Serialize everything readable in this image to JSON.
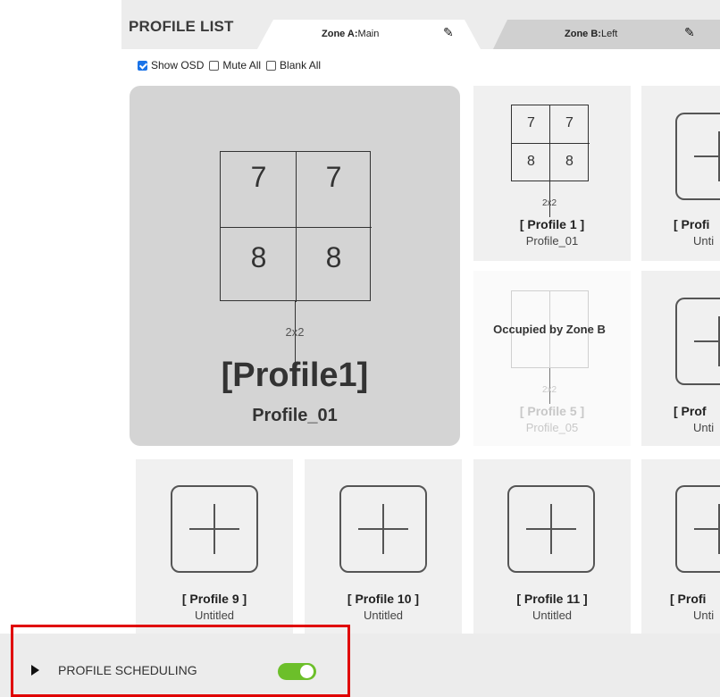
{
  "header": {
    "title": "PROFILE LIST"
  },
  "zones": [
    {
      "prefix": "Zone A:",
      "name": "Main"
    },
    {
      "prefix": "Zone B:",
      "name": "Left"
    }
  ],
  "options": {
    "show_osd": "Show OSD",
    "mute_all": "Mute All",
    "blank_all": "Blank All"
  },
  "selected": {
    "title": "[Profile1]",
    "subtitle": "Profile_01",
    "layout": "2x2",
    "cells": [
      "7",
      "7",
      "8",
      "8"
    ]
  },
  "profiles": [
    {
      "title": "[ Profile 1 ]",
      "subtitle": "Profile_01",
      "layout": "2x2",
      "cells": [
        "7",
        "7",
        "8",
        "8"
      ]
    },
    {
      "title": "[ Profi",
      "subtitle": "Unti"
    },
    {
      "title": "[ Profile 5 ]",
      "subtitle": "Profile_05",
      "layout": "2x2",
      "overlay": "Occupied by Zone B"
    },
    {
      "title": "[ Prof",
      "subtitle": "Unti"
    },
    {
      "title": "[ Profile 9 ]",
      "subtitle": "Untitled"
    },
    {
      "title": "[ Profile 10 ]",
      "subtitle": "Untitled"
    },
    {
      "title": "[ Profile 11 ]",
      "subtitle": "Untitled"
    },
    {
      "title": "[ Profi",
      "subtitle": "Unti"
    }
  ],
  "scheduling": {
    "label": "PROFILE SCHEDULING",
    "enabled": true
  },
  "colors": {
    "toggle_on": "#6cbf2a",
    "highlight": "#e00000",
    "checkbox": "#1a73e8"
  }
}
